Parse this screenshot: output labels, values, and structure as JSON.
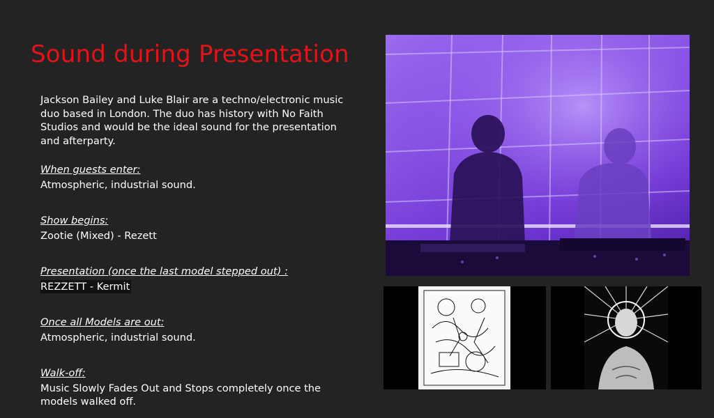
{
  "slide": {
    "title": "Sound during Presentation",
    "intro": "Jackson Bailey and Luke Blair are a techno/electronic music duo based in London. The duo has history with No Faith Studios and would be the ideal sound for the presentation and afterparty.",
    "sections": [
      {
        "heading": "When guests enter:",
        "value": "Atmospheric, industrial sound."
      },
      {
        "heading": "Show begins:",
        "value": "Zootie (Mixed) - Rezett"
      },
      {
        "heading": "Presentation (once the last model stepped out) :",
        "value": "REZZETT - Kermit"
      },
      {
        "heading": "Once all Models are out:",
        "value": "Atmospheric, industrial sound."
      },
      {
        "heading": "Walk-off:",
        "value": "Music Slowly Fades Out and Stops completely once the models walked off."
      }
    ]
  },
  "images": {
    "main_photo": "dj-duo-purple-stage-photo",
    "thumb_1": "sketch-illustration-artwork",
    "thumb_2": "radiant-figure-illustration-artwork"
  },
  "colors": {
    "background": "#232323",
    "title": "#e3131b",
    "text": "#ffffff",
    "photo_tint": "#8a55e6"
  }
}
